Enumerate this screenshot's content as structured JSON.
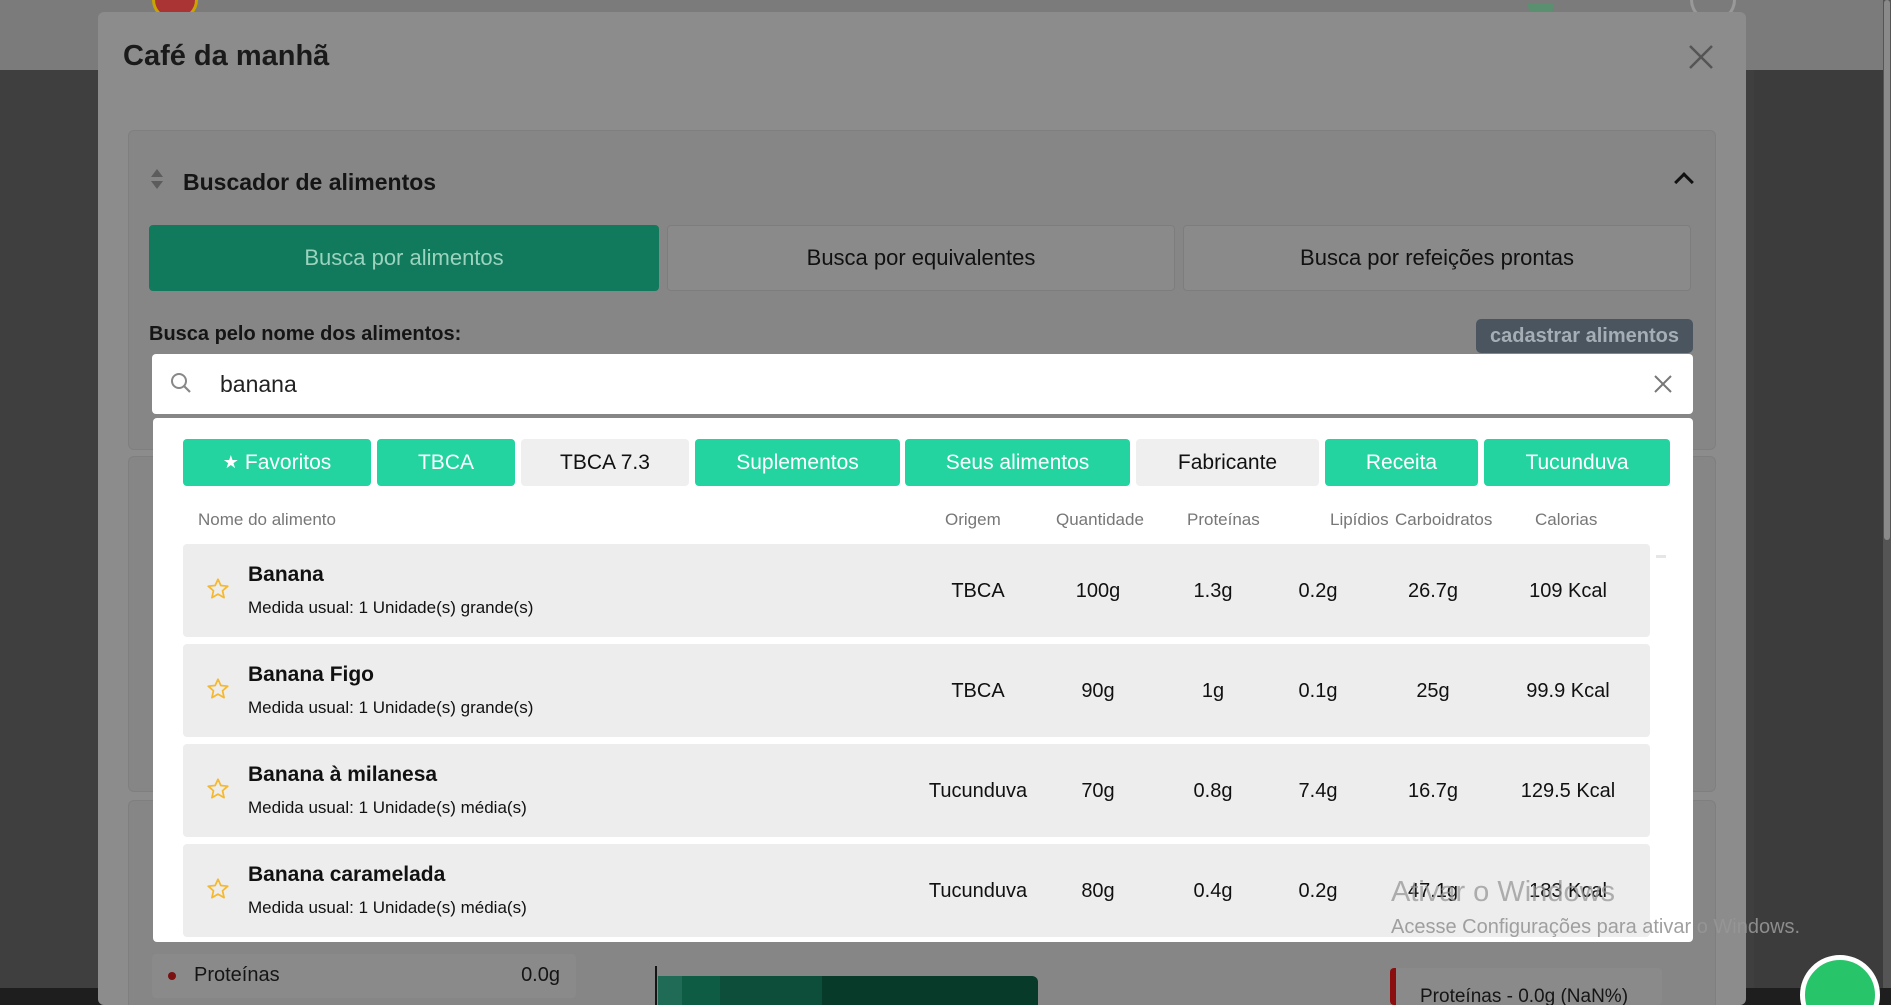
{
  "modal": {
    "title": "Café da manhã",
    "close_icon": "close-icon"
  },
  "food_search": {
    "title": "Buscador de alimentos",
    "tabs": [
      {
        "label": "Busca por alimentos",
        "active": true
      },
      {
        "label": "Busca por equivalentes",
        "active": false
      },
      {
        "label": "Busca por refeições prontas",
        "active": false
      }
    ],
    "search_label": "Busca pelo nome dos alimentos:",
    "register_button": "cadastrar alimentos",
    "search_value": "banana",
    "search_placeholder": ""
  },
  "filters": [
    {
      "label": "Favoritos",
      "active": true,
      "icon": "star-icon"
    },
    {
      "label": "TBCA",
      "active": true
    },
    {
      "label": "TBCA 7.3",
      "active": false
    },
    {
      "label": "Suplementos",
      "active": true
    },
    {
      "label": "Seus alimentos",
      "active": true
    },
    {
      "label": "Fabricante",
      "active": false
    },
    {
      "label": "Receita",
      "active": true
    },
    {
      "label": "Tucunduva",
      "active": true
    }
  ],
  "columns": {
    "name": "Nome do alimento",
    "origin": "Origem",
    "quantity": "Quantidade",
    "proteins": "Proteínas",
    "lipids": "Lipídios",
    "carbs": "Carboidratos",
    "calories": "Calorias"
  },
  "results": [
    {
      "name": "Banana",
      "measure": "Medida usual: 1 Unidade(s) grande(s)",
      "origin": "TBCA",
      "quantity": "100g",
      "proteins": "1.3g",
      "lipids": "0.2g",
      "carbs": "26.7g",
      "calories": "109 Kcal"
    },
    {
      "name": "Banana Figo",
      "measure": "Medida usual: 1 Unidade(s) grande(s)",
      "origin": "TBCA",
      "quantity": "90g",
      "proteins": "1g",
      "lipids": "0.1g",
      "carbs": "25g",
      "calories": "99.9 Kcal"
    },
    {
      "name": "Banana à milanesa",
      "measure": "Medida usual: 1 Unidade(s) média(s)",
      "origin": "Tucunduva",
      "quantity": "70g",
      "proteins": "0.8g",
      "lipids": "7.4g",
      "carbs": "16.7g",
      "calories": "129.5 Kcal"
    },
    {
      "name": "Banana caramelada",
      "measure": "Medida usual: 1 Unidade(s) média(s)",
      "origin": "Tucunduva",
      "quantity": "80g",
      "proteins": "0.4g",
      "lipids": "0.2g",
      "carbs": "47.1g",
      "calories": "183 Kcal"
    }
  ],
  "macros": {
    "left_label": "Proteínas",
    "left_value": "0.0g",
    "right_label": "Proteínas - 0.0g (NaN%)"
  },
  "watermark": {
    "title": "Ativar o Windows",
    "subtitle": "Acesse Configurações para ativar o Windows."
  },
  "colors": {
    "accent": "#23d3a0",
    "active_tab_dimmed": "#127a5c",
    "star": "#f5b82e"
  }
}
